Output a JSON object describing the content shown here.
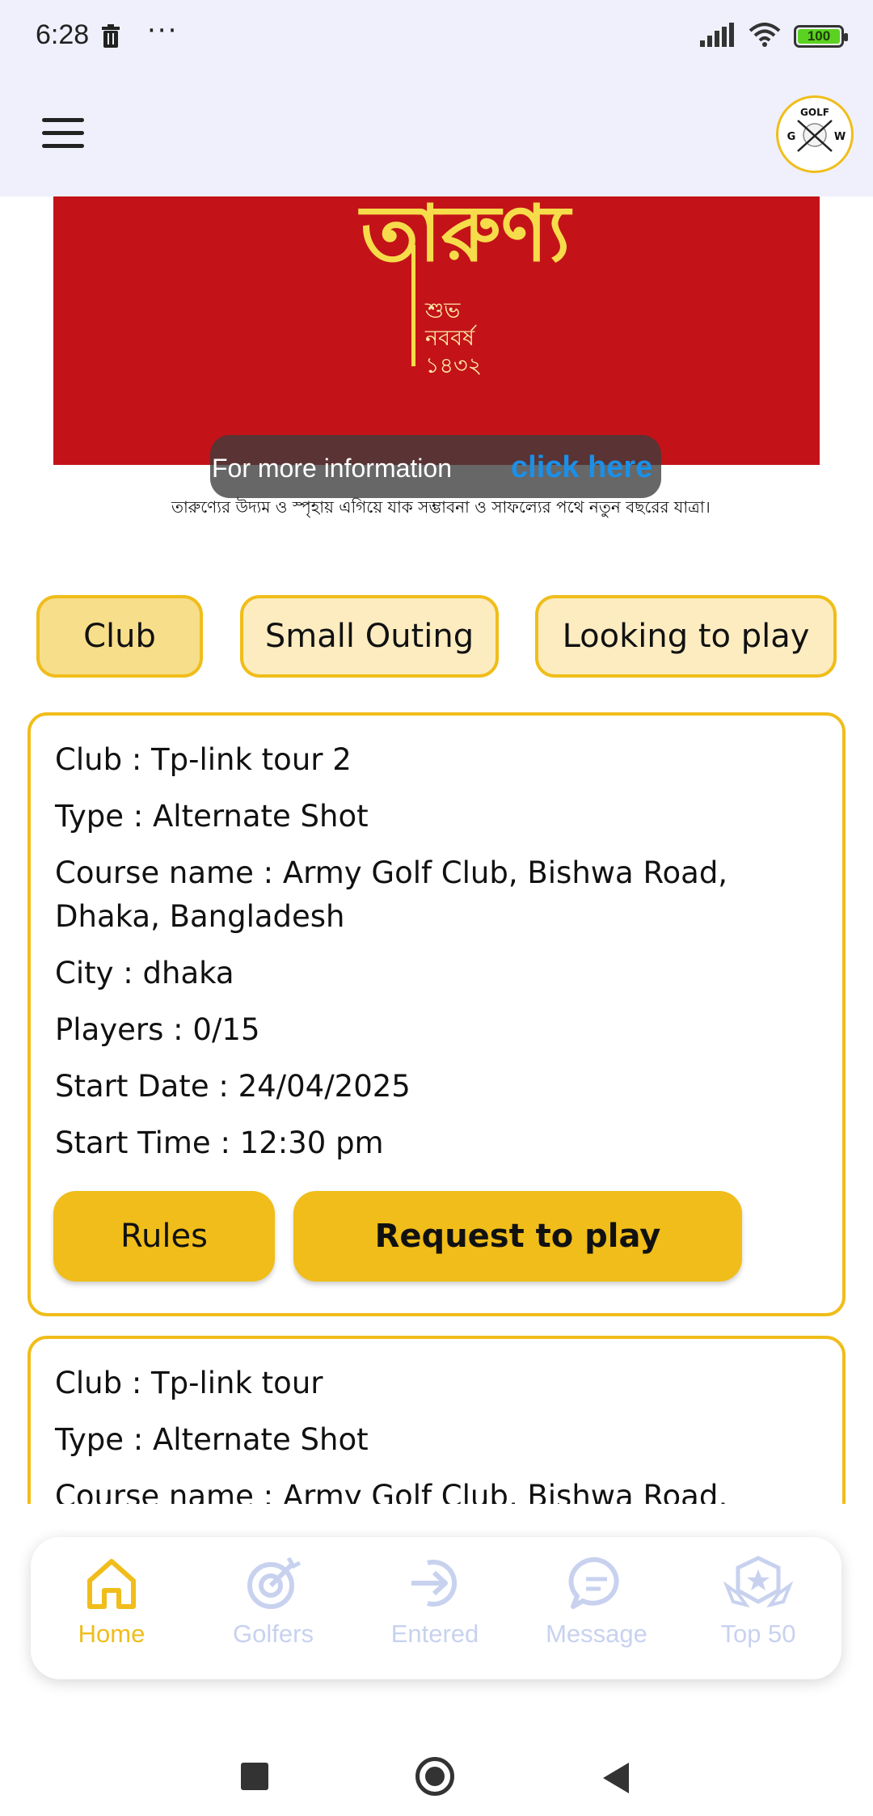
{
  "status_bar": {
    "time": "6:28",
    "dots": "···",
    "battery": "100"
  },
  "banner": {
    "title": "তারুণ্য",
    "subtitle_lines": [
      "শুভ",
      "নববর্ষ",
      "১৪৩২"
    ],
    "info_text": "For more information",
    "info_link": "click here",
    "caption": "তারুণ্যের উদ্যম ও স্পৃহায় এগিয়ে যাক সম্ভাবনা ও সাফল্যের পথে নতুন বছরের যাত্রা।"
  },
  "filters": [
    "Club",
    "Small Outing",
    "Looking to play"
  ],
  "cards": [
    {
      "club": "Club : Tp-link tour 2",
      "type": "Type : Alternate Shot",
      "course_line1": "Course name : Army Golf Club, Bishwa Road,",
      "course_line2": "Dhaka, Bangladesh",
      "city": "City : dhaka",
      "players": "Players : 0/15",
      "start_date": "Start Date : 24/04/2025",
      "start_time": "Start Time : 12:30 pm",
      "rules_label": "Rules",
      "request_label": "Request to play"
    },
    {
      "club": "Club : Tp-link tour",
      "type": "Type : Alternate Shot",
      "course_line1": "Course name : Army Golf Club, Bishwa Road,"
    }
  ],
  "nav": [
    {
      "label": "Home",
      "icon": "home-icon",
      "active": true
    },
    {
      "label": "Golfers",
      "icon": "golfers-icon",
      "active": false
    },
    {
      "label": "Entered",
      "icon": "entered-icon",
      "active": false
    },
    {
      "label": "Message",
      "icon": "message-icon",
      "active": false
    },
    {
      "label": "Top 50",
      "icon": "top50-icon",
      "active": false
    }
  ],
  "colors": {
    "accent": "#f0bd1a",
    "inactive_nav": "#c8d2ef",
    "link": "#1a90e8"
  }
}
